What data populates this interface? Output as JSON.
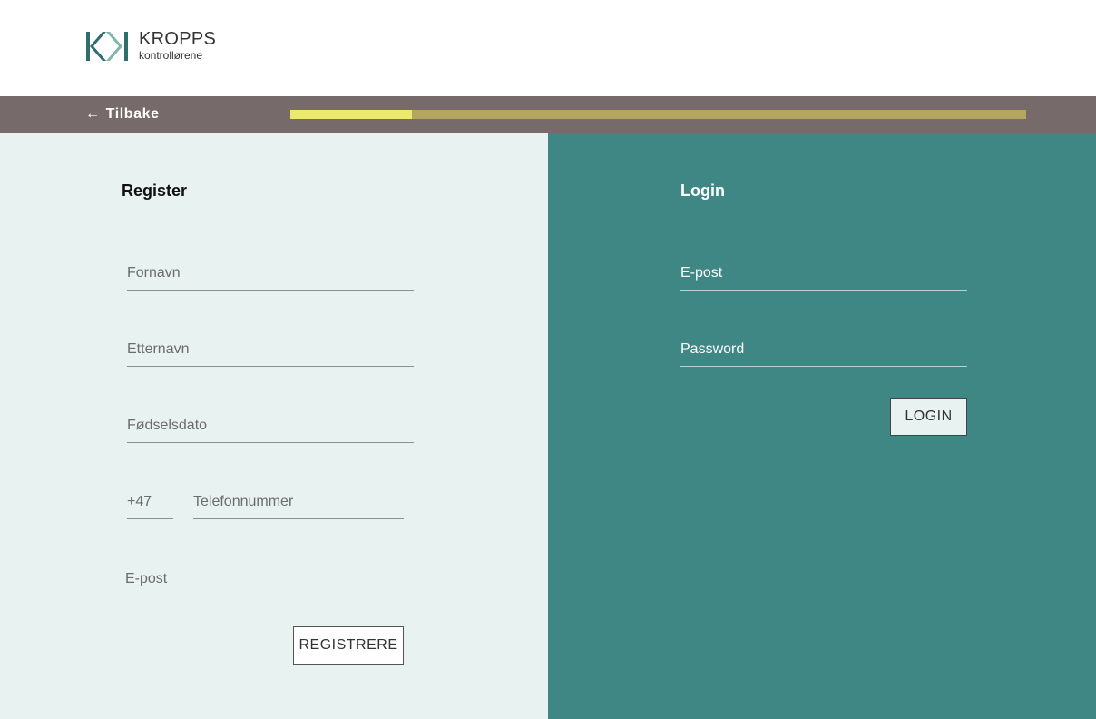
{
  "brand": {
    "name": "KROPPS",
    "tagline": "kontrollørene",
    "colors": {
      "dark": "#2f6e6d",
      "light": "#7fb5ad"
    }
  },
  "nav": {
    "back_icon": "arrow-left-icon",
    "back_arrow": "←",
    "back_label": "Tilbake",
    "progress_fraction": 0.165,
    "progress_colors": {
      "fill": "#ede96a",
      "track": "#b4a660"
    }
  },
  "register": {
    "title": "Register",
    "fields": {
      "first_name": "Fornavn",
      "last_name": "Etternavn",
      "birthdate": "Fødselsdato",
      "country_code": "+47",
      "phone": "Telefonnummer",
      "email": "E-post"
    },
    "button": "REGISTRERE",
    "background": "#e8f2f0"
  },
  "login": {
    "title": "Login",
    "fields": {
      "email": "E-post",
      "password": "Password"
    },
    "button": "LOGIN",
    "background": "#3f8785"
  }
}
